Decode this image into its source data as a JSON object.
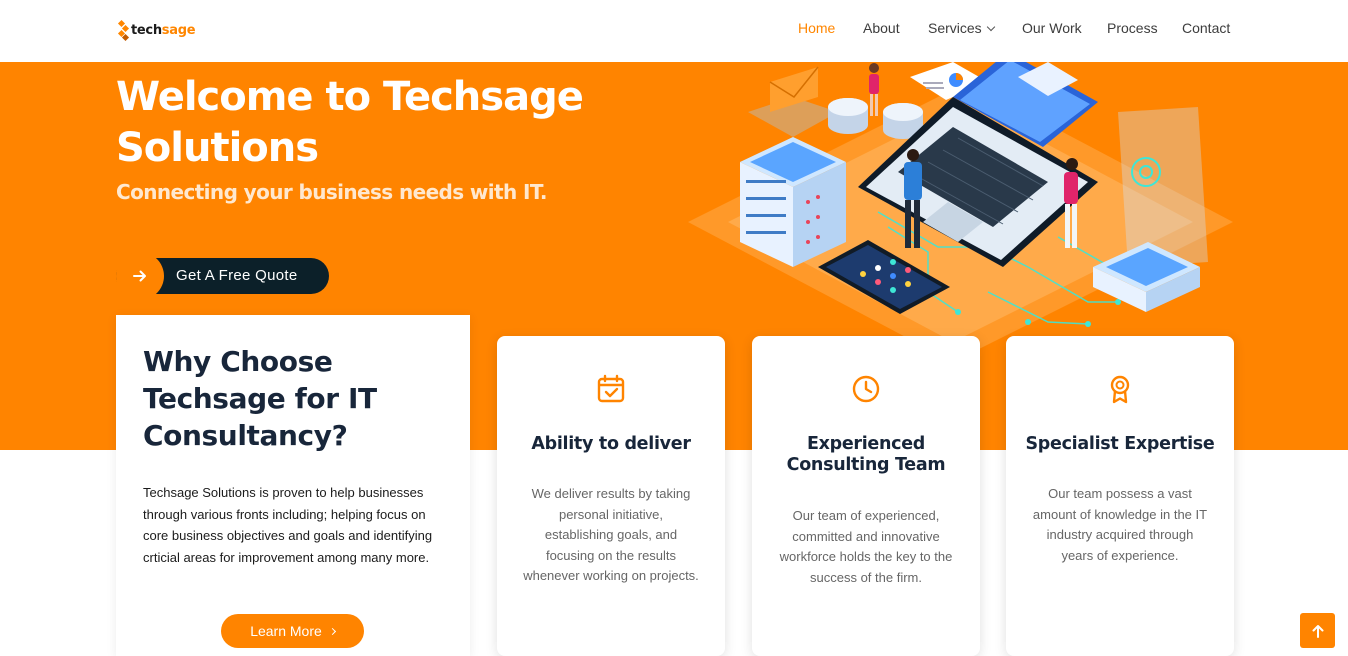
{
  "header": {
    "logo": {
      "prefix": "tech",
      "suffix": "sage"
    },
    "nav": [
      {
        "label": "Home",
        "active": true
      },
      {
        "label": "About"
      },
      {
        "label": "Services",
        "dropdown": true
      },
      {
        "label": "Our Work"
      },
      {
        "label": "Process"
      },
      {
        "label": "Contact"
      }
    ]
  },
  "hero": {
    "title": "Welcome to Techsage Solutions",
    "subtitle": "Connecting your business needs with IT.",
    "cta_label": "Get A Free Quote",
    "cta_icon": "arrow-right-icon"
  },
  "why": {
    "title": "Why Choose Techsage for IT Consultancy?",
    "text": "Techsage Solutions is proven to help businesses through various fronts including; helping focus on core business objectives and goals and identifying crticial areas for improvement among many more.",
    "button_label": "Learn More"
  },
  "features": [
    {
      "icon": "calendar-check-icon",
      "title": "Ability to deliver",
      "text": "We deliver results by taking personal initiative, establishing goals, and focusing on the results whenever working on projects."
    },
    {
      "icon": "clock-icon",
      "title": "Experienced Consulting Team",
      "text": "Our team of experienced, committed and innovative workforce holds the key to the success of the firm."
    },
    {
      "icon": "award-icon",
      "title": "Specialist Expertise",
      "text": "Our team possess a vast amount of knowledge in the IT industry acquired through years of experience."
    }
  ],
  "colors": {
    "accent": "#ff8400",
    "dark": "#0c2029",
    "heading": "#18263a"
  },
  "scroll_top_icon": "arrow-up-icon"
}
